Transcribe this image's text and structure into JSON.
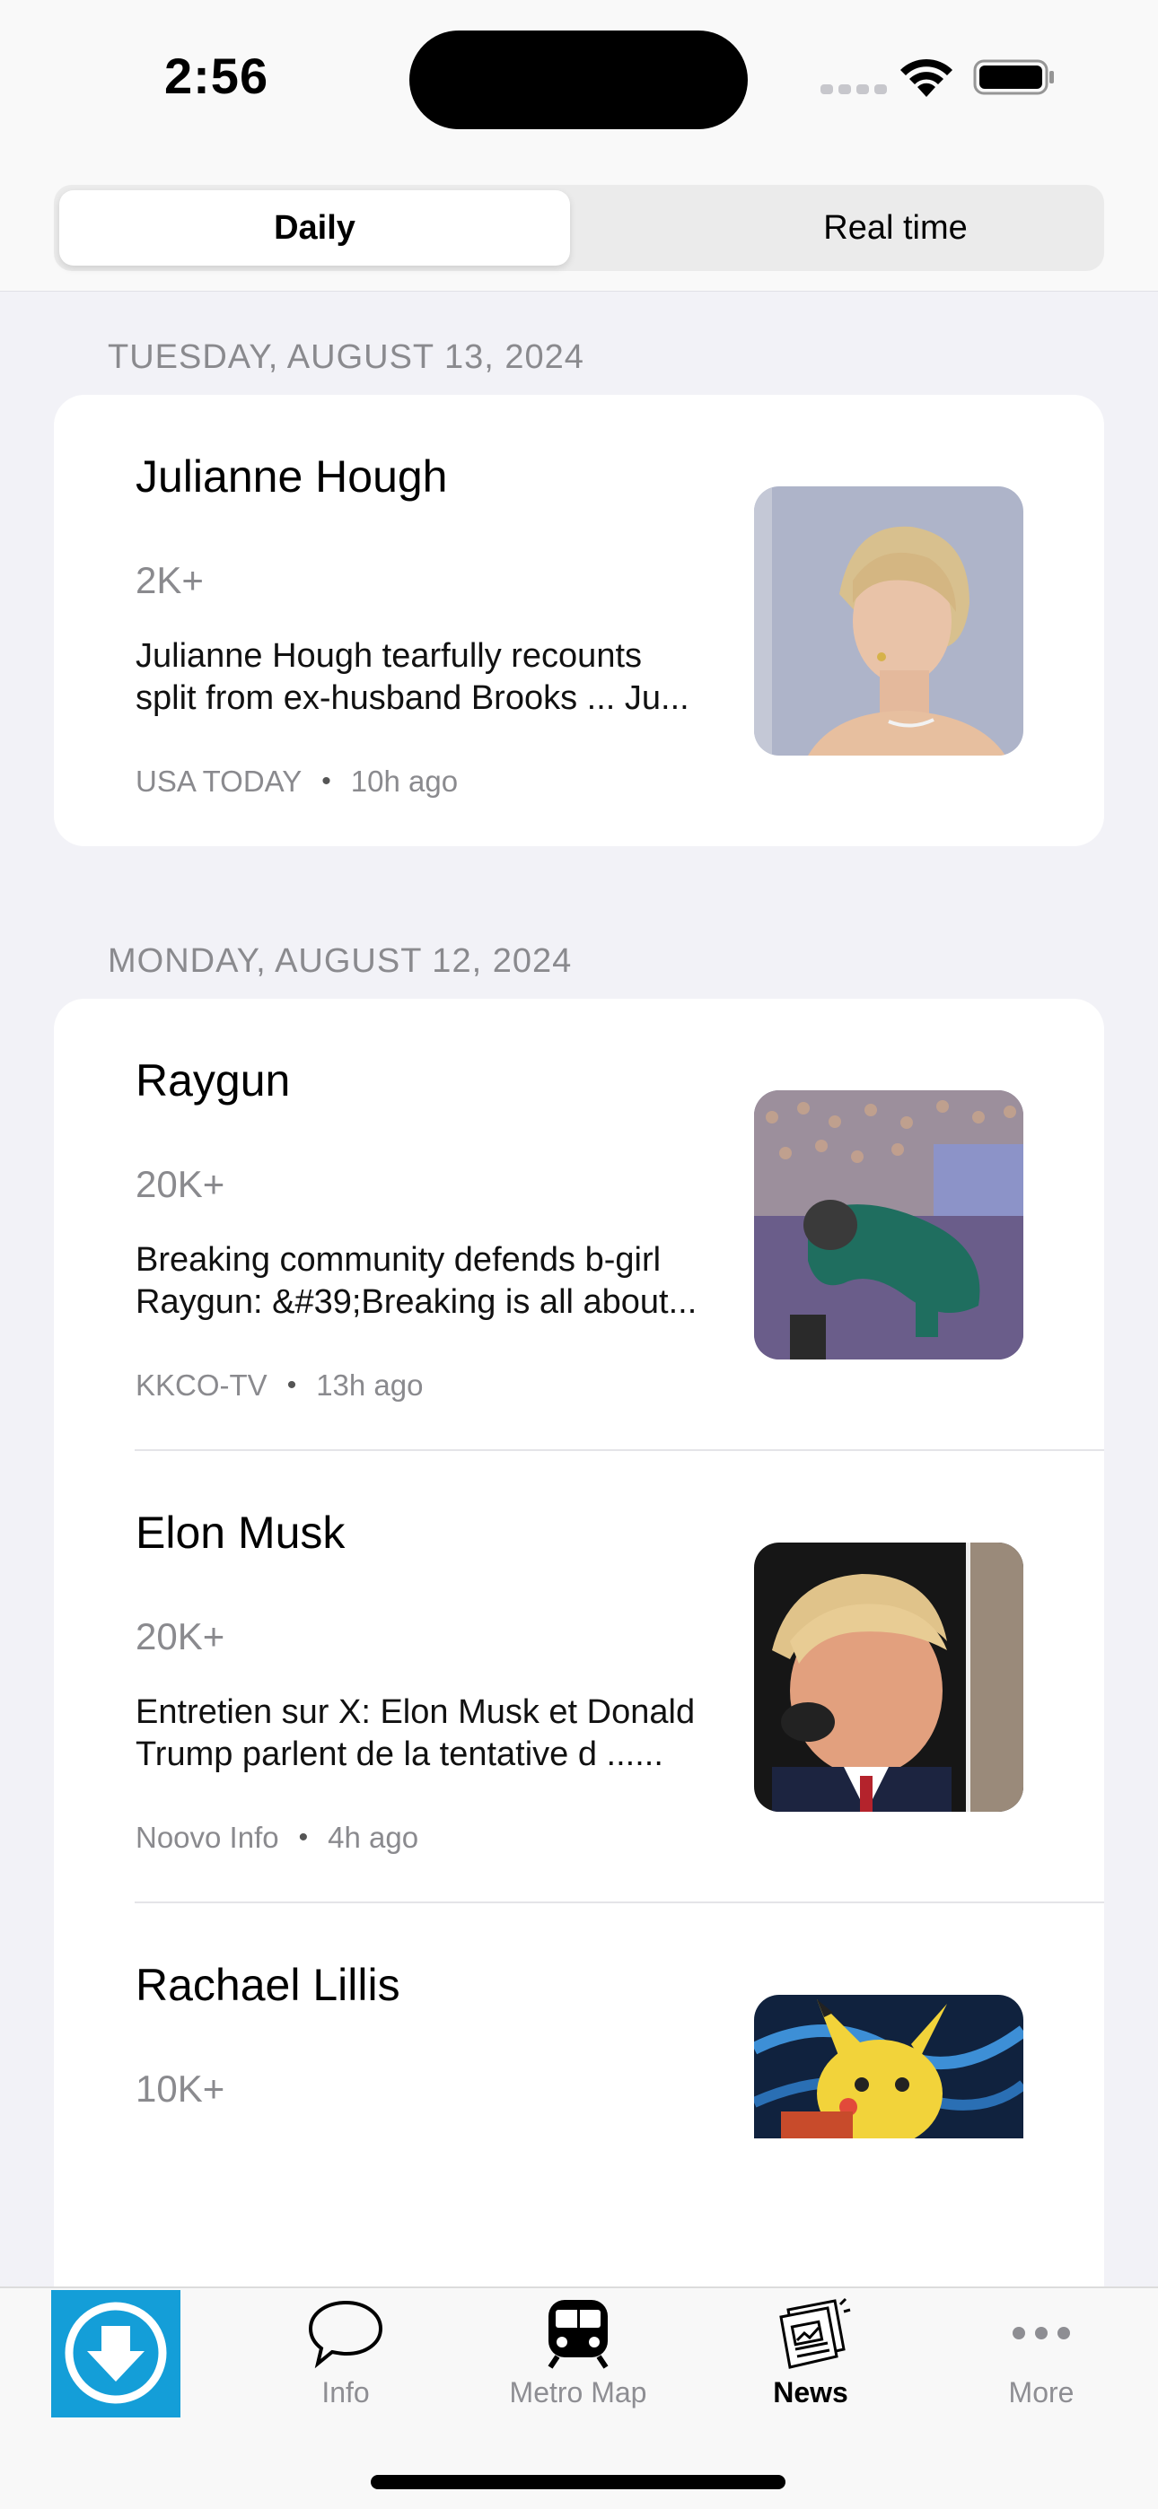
{
  "status_bar": {
    "time": "2:56"
  },
  "segmented": {
    "daily": "Daily",
    "realtime": "Real time",
    "selected": "Daily"
  },
  "sections": [
    {
      "date": "TUESDAY, AUGUST 13, 2024",
      "items": [
        {
          "title": "Julianne Hough",
          "count": "2K+",
          "desc_line1": "Julianne Hough tearfully recounts",
          "desc_line2": "split from ex-husband Brooks ... Ju...",
          "source": "USA TODAY",
          "time": "10h ago"
        }
      ]
    },
    {
      "date": "MONDAY, AUGUST 12, 2024",
      "items": [
        {
          "title": "Raygun",
          "count": "20K+",
          "desc_line1": "Breaking community defends b-girl",
          "desc_line2": "Raygun: &#39;Breaking is all about...",
          "source": "KKCO-TV",
          "time": "13h ago"
        },
        {
          "title": "Elon Musk",
          "count": "20K+",
          "desc_line1": "Entretien sur X: Elon Musk et Donald",
          "desc_line2": "Trump parlent de la tentative d ......",
          "source": "Noovo Info",
          "time": "4h ago"
        },
        {
          "title": "Rachael Lillis",
          "count": "10K+"
        }
      ]
    }
  ],
  "tab_bar": {
    "tabs": [
      {
        "label": "Info",
        "icon": "speech-bubble-icon"
      },
      {
        "label": "Metro Map",
        "icon": "metro-train-icon"
      },
      {
        "label": "News",
        "icon": "newspaper-icon",
        "active": true
      },
      {
        "label": "More",
        "icon": "ellipsis-icon"
      }
    ],
    "logo_icon": "stm-logo-icon"
  },
  "colors": {
    "accent": "#149ed8",
    "secondary_text": "#8a8a8e",
    "background": "#f2f2f7"
  }
}
